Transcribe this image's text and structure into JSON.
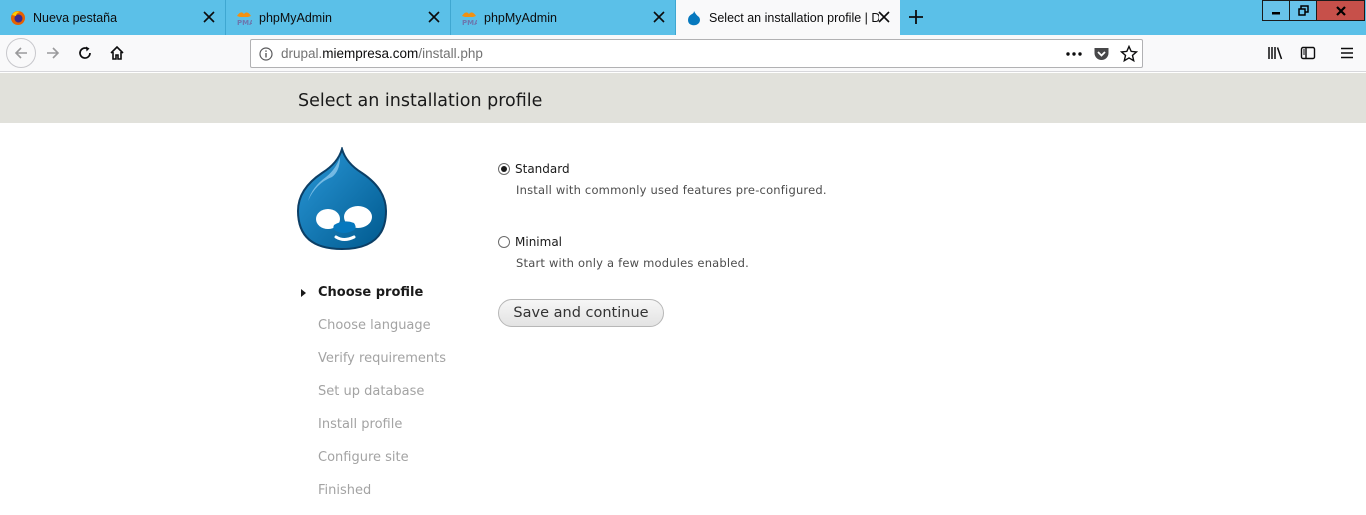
{
  "browser": {
    "tabs": [
      {
        "title": "Nueva pestaña",
        "icon": "firefox-icon"
      },
      {
        "title": "phpMyAdmin",
        "icon": "phpmyadmin-icon"
      },
      {
        "title": "phpMyAdmin",
        "icon": "phpmyadmin-icon"
      },
      {
        "title": "Select an installation profile | Dr",
        "icon": "drupal-icon",
        "active": true
      }
    ],
    "url": {
      "prefix": "drupal.",
      "domain": "miempresa.com",
      "path": "/install.php"
    },
    "colors": {
      "tabstrip": "#5bc0e8",
      "close_button": "#c7504a"
    }
  },
  "page": {
    "title": "Select an installation profile",
    "steps": [
      {
        "label": "Choose profile",
        "active": true
      },
      {
        "label": "Choose language"
      },
      {
        "label": "Verify requirements"
      },
      {
        "label": "Set up database"
      },
      {
        "label": "Install profile"
      },
      {
        "label": "Configure site"
      },
      {
        "label": "Finished"
      }
    ],
    "options": {
      "standard": {
        "label": "Standard",
        "description": "Install with commonly used features pre-configured.",
        "selected": true
      },
      "minimal": {
        "label": "Minimal",
        "description": "Start with only a few modules enabled.",
        "selected": false
      }
    },
    "submit_label": "Save and continue",
    "colors": {
      "header_bg": "#e1e1db",
      "drupal_blue": "#0678be"
    }
  }
}
